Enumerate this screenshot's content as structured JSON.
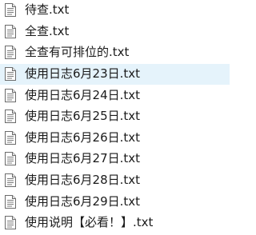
{
  "files": [
    {
      "name": "待查.txt",
      "icon": "text-file-icon"
    },
    {
      "name": "全查.txt",
      "icon": "text-file-icon"
    },
    {
      "name": "全查有可排位的.txt",
      "icon": "text-file-icon"
    },
    {
      "name": "使用日志6月23日.txt",
      "icon": "text-file-icon",
      "selected": true
    },
    {
      "name": "使用日志6月24日.txt",
      "icon": "text-file-icon"
    },
    {
      "name": "使用日志6月25日.txt",
      "icon": "text-file-icon"
    },
    {
      "name": "使用日志6月26日.txt",
      "icon": "text-file-icon"
    },
    {
      "name": "使用日志6月27日.txt",
      "icon": "text-file-icon"
    },
    {
      "name": "使用日志6月28日.txt",
      "icon": "text-file-icon"
    },
    {
      "name": "使用日志6月29日.txt",
      "icon": "text-file-icon"
    },
    {
      "name": "使用说明【必看！】.txt",
      "icon": "text-file-icon"
    }
  ],
  "colors": {
    "selected_row": "#e5f3fb",
    "text": "#1a1a1a"
  }
}
